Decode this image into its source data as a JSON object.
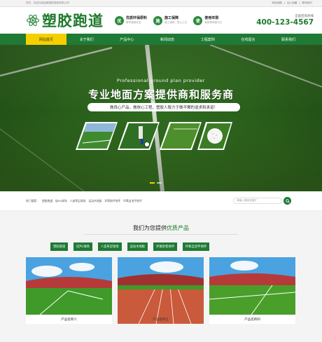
{
  "topbar": {
    "welcome": "您好，欢迎光临蓝魔塑胶跑道有限公司！",
    "links": [
      "网站地图",
      "加入收藏",
      "联系我们"
    ]
  },
  "header": {
    "logo_text": "塑胶跑道",
    "features": [
      {
        "icon": "优",
        "title": "优质环保原料",
        "desc": "更环保更安全"
      },
      {
        "icon": "施",
        "title": "施工保障",
        "desc": "施工保障，匠心工艺"
      },
      {
        "icon": "使",
        "title": "使用年限",
        "desc": "使用寿命更长久"
      }
    ],
    "hotline_label": "全国咨询热线",
    "hotline_number": "400-123-4567"
  },
  "nav": {
    "items": [
      "网站首页",
      "关于我们",
      "产品中心",
      "新闻动态",
      "工程案例",
      "在线留言",
      "联系我们"
    ],
    "active_index": 0
  },
  "banner": {
    "en_title": "Professional ground plan provider",
    "cn_title": "专业地面方案提供商和服务商",
    "subtitle": "做良心产品，做放心工程，塑胶人致力于做不懈的追求和承诺！",
    "slide_count": 2,
    "active_slide": 0
  },
  "search": {
    "hot_label": "热门搜索：",
    "keywords": [
      "塑胶跑道",
      "硅PU球场",
      "人造草足球场",
      "运动木地板",
      "环氧地坪地坪",
      "环氧自流平地坪"
    ],
    "placeholder": "请输入搜索关键字"
  },
  "products": {
    "title_prefix": "我们为您提供",
    "title_highlight": "优质产品",
    "categories": [
      "塑胶跑道",
      "硅PU球场",
      "人造草足球场",
      "运动木地板",
      "环氧砂浆地坪",
      "环氧自流平地坪"
    ],
    "cards": [
      {
        "name": "产品名称六"
      },
      {
        "name": "产品名称五"
      },
      {
        "name": "产品名称四"
      }
    ]
  },
  "colors": {
    "brand_green": "#1e7a34",
    "accent_yellow": "#f5d000"
  }
}
